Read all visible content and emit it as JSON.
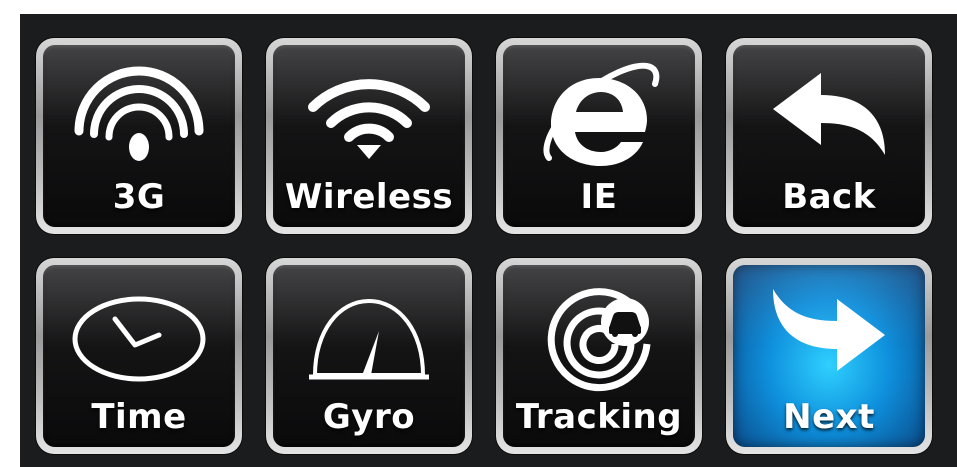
{
  "tiles": [
    {
      "label": "3G",
      "icon": "signal-3g-icon",
      "active": false
    },
    {
      "label": "Wireless",
      "icon": "wifi-icon",
      "active": false
    },
    {
      "label": "IE",
      "icon": "internet-explorer-icon",
      "active": false
    },
    {
      "label": "Back",
      "icon": "back-arrow-icon",
      "active": false
    },
    {
      "label": "Time",
      "icon": "clock-icon",
      "active": false
    },
    {
      "label": "Gyro",
      "icon": "gauge-icon",
      "active": false
    },
    {
      "label": "Tracking",
      "icon": "car-tracking-icon",
      "active": false
    },
    {
      "label": "Next",
      "icon": "next-arrow-icon",
      "active": true
    }
  ],
  "colors": {
    "panel_background": "#1b1c1e",
    "active_tile": "#0e8fdc",
    "label_text": "#ffffff"
  }
}
